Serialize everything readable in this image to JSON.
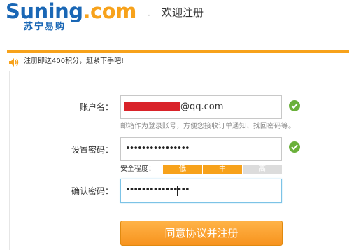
{
  "header": {
    "logo_en_a": "Suning",
    "logo_en_b": ".com",
    "logo_cn": "苏宁易购",
    "separator": "·",
    "page_title": "欢迎注册"
  },
  "notice": {
    "icon": "speaker-icon",
    "text": "注册即送400积分，赶紧下手吧!"
  },
  "form": {
    "account": {
      "label": "账户名：",
      "value_suffix": "@qq.com",
      "hint": "邮箱作为登录账号，方便您接收订单通知、找回密码等。",
      "status_icon": "check-icon"
    },
    "password": {
      "label": "设置密码：",
      "masked_value": "••••••••••••••••",
      "status_icon": "check-icon"
    },
    "strength": {
      "label": "安全程度：",
      "levels": [
        "低",
        "中",
        "高"
      ],
      "active_count": 2
    },
    "confirm": {
      "label": "确认密码：",
      "masked_value": "••••••••••••••••"
    },
    "submit_label": "同意协议并注册"
  },
  "colors": {
    "brand_blue": "#1a67b5",
    "brand_orange": "#f7a21b",
    "ok_green": "#6ab03a"
  }
}
